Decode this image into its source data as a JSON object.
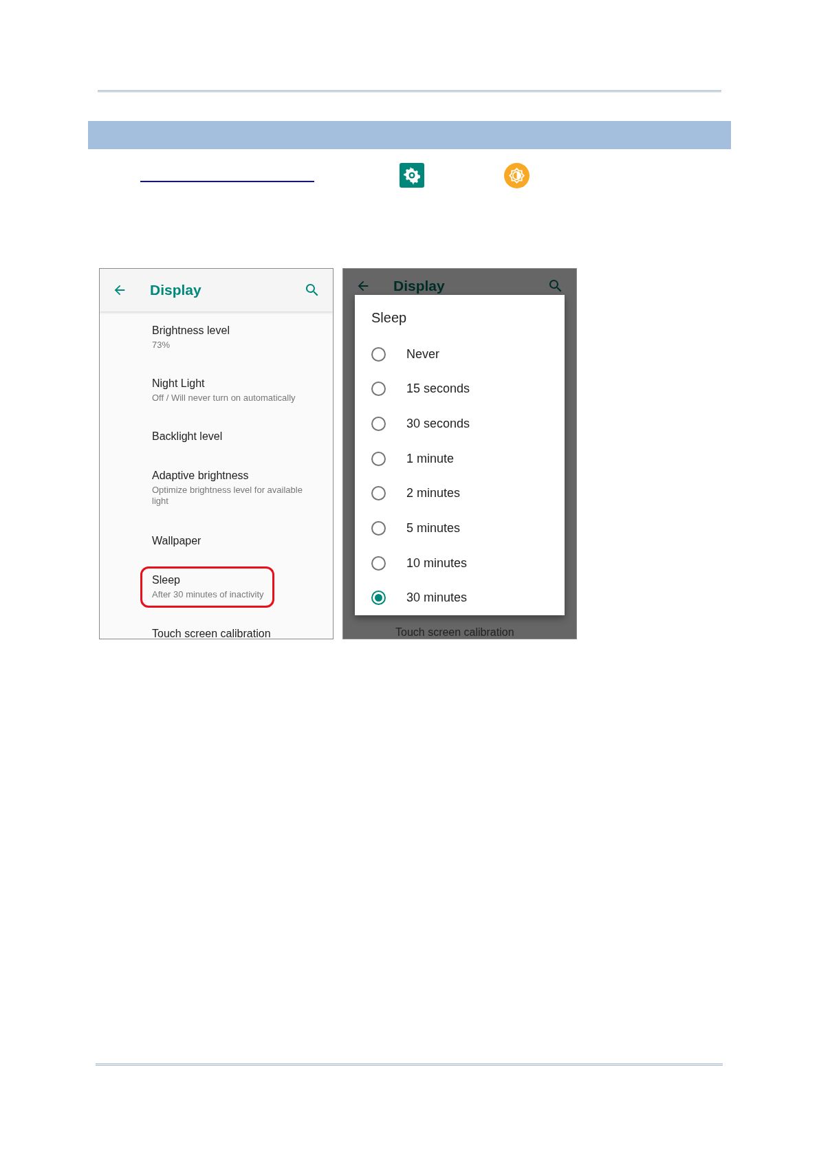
{
  "settings_screen": {
    "title": "Display",
    "items": [
      {
        "title": "Brightness level",
        "summary": "73%",
        "highlighted": false
      },
      {
        "title": "Night Light",
        "summary": "Off / Will never turn on automatically",
        "highlighted": false
      },
      {
        "title": "Backlight level",
        "highlighted": false
      },
      {
        "title": "Adaptive brightness",
        "summary": "Optimize brightness level for available light",
        "highlighted": false
      },
      {
        "title": "Wallpaper",
        "highlighted": false
      },
      {
        "title": "Sleep",
        "summary": "After 30 minutes of inactivity",
        "highlighted": true
      },
      {
        "title": "Touch screen calibration",
        "highlighted": false
      }
    ]
  },
  "sleep_dialog": {
    "background_title": "Display",
    "background_item": "Touch screen calibration",
    "title": "Sleep",
    "options": [
      {
        "label": "Never",
        "selected": false
      },
      {
        "label": "15 seconds",
        "selected": false
      },
      {
        "label": "30 seconds",
        "selected": false
      },
      {
        "label": "1 minute",
        "selected": false
      },
      {
        "label": "2 minutes",
        "selected": false
      },
      {
        "label": "5 minutes",
        "selected": false
      },
      {
        "label": "10 minutes",
        "selected": false
      },
      {
        "label": "30 minutes",
        "selected": true
      }
    ]
  }
}
